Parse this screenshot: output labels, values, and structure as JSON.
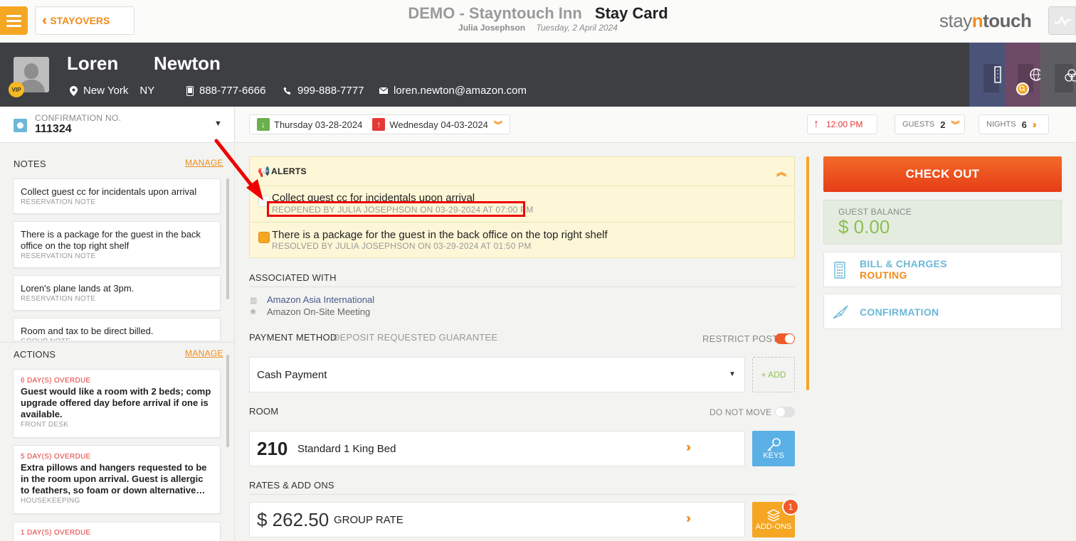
{
  "topbar": {
    "back_label": "STAYOVERS",
    "hotel_name": "DEMO - Stayntouch Inn",
    "page_title": "Stay Card",
    "user": "Julia Josephson",
    "date": "Tuesday, 2 April 2024",
    "logo_part1": "stay",
    "logo_part2": "n",
    "logo_part3": "touch"
  },
  "guest": {
    "first_name": "Loren",
    "last_name": "Newton",
    "vip": "VIP",
    "city": "New York",
    "state": "NY",
    "phone": "888-777-6666",
    "mobile": "999-888-7777",
    "email": "loren.newton@amazon.com"
  },
  "confirmation": {
    "label": "CONFIRMATION NO.",
    "number": "111324"
  },
  "stay": {
    "arrival": "Thursday 03-28-2024",
    "departure": "Wednesday 04-03-2024",
    "time": "12:00 PM",
    "guests_label": "GUESTS",
    "guests": "2",
    "nights_label": "NIGHTS",
    "nights": "6"
  },
  "notes": {
    "title": "NOTES",
    "manage": "MANAGE",
    "items": [
      {
        "text": "Collect guest cc for incidentals upon arrival",
        "type": "RESERVATION NOTE"
      },
      {
        "text": "There is a package for the guest in the back office on the top right shelf",
        "type": "RESERVATION NOTE"
      },
      {
        "text": "Loren's plane lands at 3pm.",
        "type": "RESERVATION NOTE"
      },
      {
        "text": "Room and tax to be direct billed.",
        "type": "GROUP NOTE"
      }
    ]
  },
  "actions": {
    "title": "ACTIONS",
    "manage": "MANAGE",
    "items": [
      {
        "due": "6 DAY(S) OVERDUE",
        "text": "Guest would like a room with 2 beds; comp upgrade offered day before arrival if one is available.",
        "dept": "FRONT DESK"
      },
      {
        "due": "5 DAY(S) OVERDUE",
        "text": "Extra pillows and hangers requested to be in the room upon arrival. Guest is allergic to feathers, so foam or down alternative…",
        "dept": "HOUSEKEEPING"
      },
      {
        "due": "1 DAY(S) OVERDUE"
      }
    ]
  },
  "alerts": {
    "title": "ALERTS",
    "items": [
      {
        "text": "Collect guest cc for incidentals upon arrival",
        "meta": "REOPENED BY JULIA JOSEPHSON ON 03-29-2024 AT 07:00 PM"
      },
      {
        "text": "There is a package for the guest in the back office on the top right shelf",
        "meta": "RESOLVED BY JULIA JOSEPHSON ON 03-29-2024 AT 01:50 PM"
      }
    ]
  },
  "associated": {
    "title": "ASSOCIATED WITH",
    "company": "Amazon Asia International",
    "group": "Amazon On-Site Meeting"
  },
  "payment": {
    "title": "PAYMENT METHOD",
    "subtitle": "DEPOSIT REQUESTED GUARANTEE",
    "restrict_label": "RESTRICT POST",
    "value": "Cash Payment",
    "add_label": "+ ADD"
  },
  "room": {
    "title": "ROOM",
    "do_not_move": "DO NOT MOVE",
    "number": "210",
    "type": "Standard 1 King Bed",
    "keys_label": "KEYS"
  },
  "rates": {
    "title": "RATES & ADD ONS",
    "amount": "$ 262.50",
    "rate_name": "GROUP RATE",
    "addons_label": "ADD-ONS",
    "addons_count": "1"
  },
  "right": {
    "checkout": "CHECK OUT",
    "balance_label": "GUEST BALANCE",
    "balance": "$ 0.00",
    "bill_line1": "BILL & CHARGES",
    "bill_line2": "ROUTING",
    "confirmation": "CONFIRMATION"
  }
}
